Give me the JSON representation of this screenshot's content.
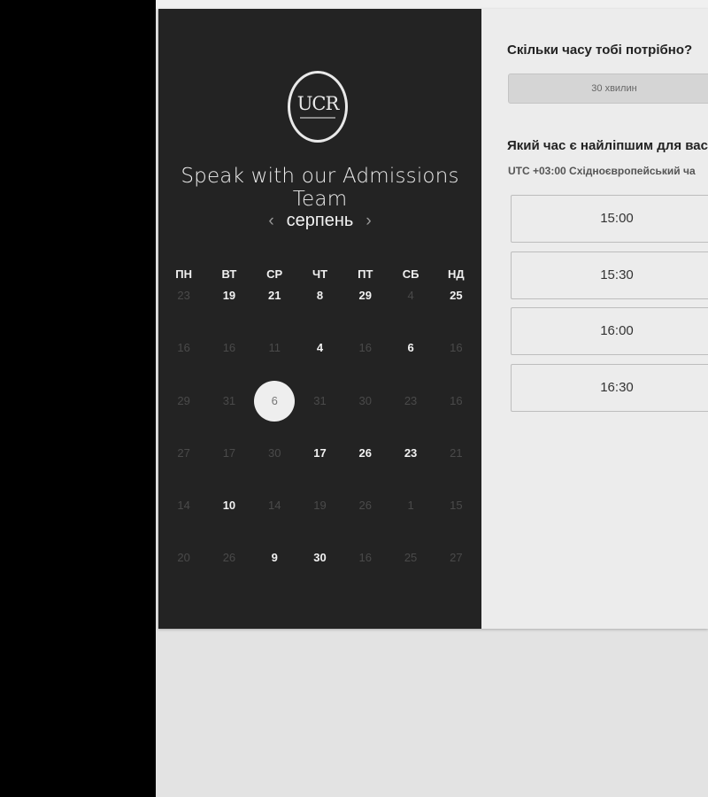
{
  "logo": {
    "text": "UCR"
  },
  "heading": "Speak with our Admissions Team",
  "calendar": {
    "prev_symbol": "‹",
    "next_symbol": "›",
    "month": "серпень",
    "weekdays": [
      "ПН",
      "ВТ",
      "СР",
      "ЧТ",
      "ПТ",
      "СБ",
      "НД"
    ],
    "weeks": [
      [
        {
          "d": "23",
          "on": false
        },
        {
          "d": "19",
          "on": true
        },
        {
          "d": "21",
          "on": true
        },
        {
          "d": "8",
          "on": true
        },
        {
          "d": "29",
          "on": true
        },
        {
          "d": "4",
          "on": false
        },
        {
          "d": "25",
          "on": true
        }
      ],
      [
        {
          "d": "16",
          "on": false
        },
        {
          "d": "16",
          "on": false
        },
        {
          "d": "11",
          "on": false
        },
        {
          "d": "4",
          "on": true
        },
        {
          "d": "16",
          "on": false
        },
        {
          "d": "6",
          "on": true
        },
        {
          "d": "16",
          "on": false
        }
      ],
      [
        {
          "d": "29",
          "on": false
        },
        {
          "d": "31",
          "on": false
        },
        {
          "d": "6",
          "on": true,
          "selected": true
        },
        {
          "d": "31",
          "on": false
        },
        {
          "d": "30",
          "on": false
        },
        {
          "d": "23",
          "on": false
        },
        {
          "d": "16",
          "on": false
        }
      ],
      [
        {
          "d": "27",
          "on": false
        },
        {
          "d": "17",
          "on": false
        },
        {
          "d": "30",
          "on": false
        },
        {
          "d": "17",
          "on": true
        },
        {
          "d": "26",
          "on": true
        },
        {
          "d": "23",
          "on": true
        },
        {
          "d": "21",
          "on": false
        }
      ],
      [
        {
          "d": "14",
          "on": false
        },
        {
          "d": "10",
          "on": true
        },
        {
          "d": "14",
          "on": false
        },
        {
          "d": "19",
          "on": false
        },
        {
          "d": "26",
          "on": false
        },
        {
          "d": "1",
          "on": false
        },
        {
          "d": "15",
          "on": false
        }
      ],
      [
        {
          "d": "20",
          "on": false
        },
        {
          "d": "26",
          "on": false
        },
        {
          "d": "9",
          "on": true
        },
        {
          "d": "30",
          "on": true
        },
        {
          "d": "16",
          "on": false
        },
        {
          "d": "25",
          "on": false
        },
        {
          "d": "27",
          "on": false
        }
      ]
    ]
  },
  "booking": {
    "duration_question": "Скільки часу тобі потрібно?",
    "duration_value": "30 хвилин",
    "time_question": "Який час є найліпшим для вас?",
    "timezone": "UTC +03:00 Східноєвропейський ча",
    "slots": [
      "15:00",
      "15:30",
      "16:00",
      "16:30"
    ]
  }
}
